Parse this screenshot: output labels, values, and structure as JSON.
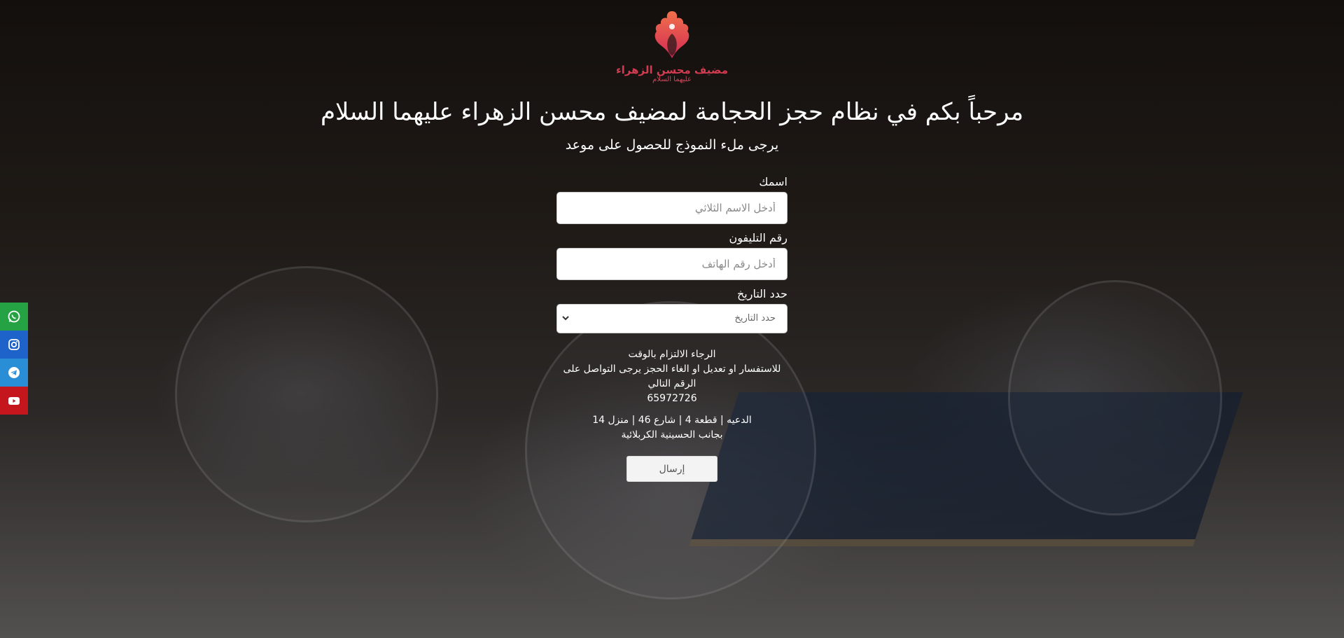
{
  "logo": {
    "name": "مضيف محسن الزهراء",
    "subtitle": "عليهما السلام"
  },
  "header": {
    "title": "مرحباً بكم في نظام حجز الحجامة لمضيف محسن الزهراء عليهما السلام",
    "subtitle": "يرجى ملء النموذج للحصول على موعد"
  },
  "form": {
    "name_label": "اسمك",
    "name_placeholder": "أدخل الاسم الثلاثي",
    "phone_label": "رقم التليفون",
    "phone_placeholder": "أدخل رقم الهاتف",
    "date_label": "حدد التاريخ",
    "date_selected": "حدد التاريخ",
    "submit_label": "إرسال"
  },
  "info": {
    "punctuality": "الرجاء الالتزام بالوقت",
    "contact_note": "للاستفسار او تعديل او الغاء الحجز يرجى التواصل على الرقم التالي",
    "phone": "65972726",
    "address_line1": "الدعيه | قطعة 4 | شارع 46 | منزل 14",
    "address_line2": "بجانب الحسينية الكربلائية"
  },
  "social": [
    {
      "icon": "whatsapp-icon",
      "color": "#25a244"
    },
    {
      "icon": "instagram-icon",
      "color": "#1d63c9"
    },
    {
      "icon": "telegram-icon",
      "color": "#2a8ed6"
    },
    {
      "icon": "youtube-icon",
      "color": "#c4161c"
    }
  ]
}
